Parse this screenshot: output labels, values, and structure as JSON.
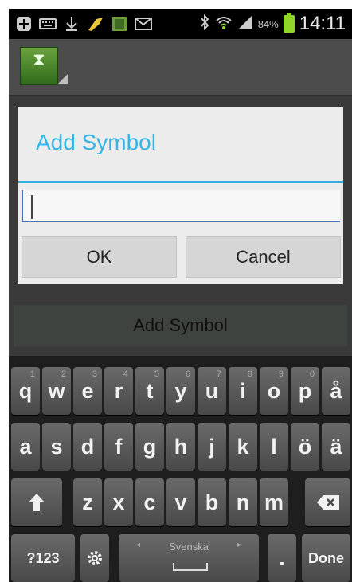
{
  "status_bar": {
    "battery_percent": "84%",
    "time": "14:11",
    "icons": [
      "plus-icon",
      "keyboard-icon",
      "download-icon",
      "paint-icon",
      "gallery-icon",
      "mail-icon",
      "bluetooth-icon",
      "wifi-icon",
      "signal-icon",
      "battery-icon"
    ]
  },
  "dialog": {
    "title": "Add Symbol",
    "input_value": "",
    "ok_label": "OK",
    "cancel_label": "Cancel"
  },
  "background": {
    "add_symbol_button_label": "Add Symbol"
  },
  "keyboard": {
    "row1": [
      {
        "key": "q",
        "hint": "1"
      },
      {
        "key": "w",
        "hint": "2"
      },
      {
        "key": "e",
        "hint": "3"
      },
      {
        "key": "r",
        "hint": "4"
      },
      {
        "key": "t",
        "hint": "5"
      },
      {
        "key": "y",
        "hint": "6"
      },
      {
        "key": "u",
        "hint": "7"
      },
      {
        "key": "i",
        "hint": "8"
      },
      {
        "key": "o",
        "hint": "9"
      },
      {
        "key": "p",
        "hint": "0"
      },
      {
        "key": "å",
        "hint": ""
      }
    ],
    "row2": [
      "a",
      "s",
      "d",
      "f",
      "g",
      "h",
      "j",
      "k",
      "l",
      "ö",
      "ä"
    ],
    "row3": [
      "z",
      "x",
      "c",
      "v",
      "b",
      "n",
      "m"
    ],
    "symbols_label": "?123",
    "space_label": "Svenska",
    "period_label": ".",
    "done_label": "Done"
  },
  "colors": {
    "accent": "#33b5e5",
    "battery": "#8fd628"
  }
}
